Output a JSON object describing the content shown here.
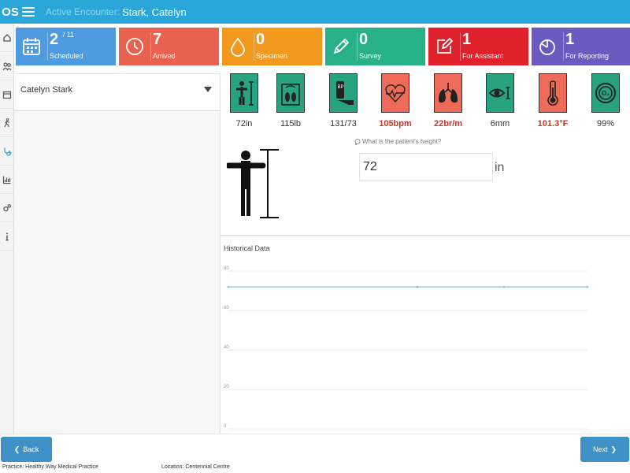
{
  "header": {
    "logo_text": "OS",
    "encounter_prefix": "Active Encounter:",
    "encounter_name": "Stark, Catelyn",
    "bg_color": "#2aa6d8"
  },
  "rail": {
    "items": [
      {
        "icon": "dashboard-icon"
      },
      {
        "icon": "patients-icon"
      },
      {
        "icon": "calendar-icon"
      },
      {
        "icon": "walking-person-icon"
      },
      {
        "icon": "stethoscope-icon",
        "active": true
      },
      {
        "icon": "bar-chart-icon"
      },
      {
        "icon": "settings-gears-icon"
      },
      {
        "icon": "info-icon"
      }
    ]
  },
  "tiles": [
    {
      "count": "2",
      "total": "/ 11",
      "label": "Scheduled",
      "color": "#4f9be0",
      "icon": "calendar-icon"
    },
    {
      "count": "7",
      "total": "",
      "label": "Arrived",
      "color": "#e8624f",
      "icon": "clock-icon"
    },
    {
      "count": "0",
      "total": "",
      "label": "Specimen",
      "color": "#f39a1e",
      "icon": "drop-icon"
    },
    {
      "count": "0",
      "total": "",
      "label": "Survey",
      "color": "#28b089",
      "icon": "pencil-icon"
    },
    {
      "count": "1",
      "total": "",
      "label": "For Assistant",
      "color": "#e0202a",
      "icon": "edit-icon"
    },
    {
      "count": "1",
      "total": "",
      "label": "For Reporting",
      "color": "#6b5bc1",
      "icon": "pie-chart-icon"
    }
  ],
  "patient": {
    "selected": "Catelyn Stark"
  },
  "vitals": [
    {
      "value": "72in",
      "color": "#28a37f",
      "icon": "height-icon",
      "alert": false
    },
    {
      "value": "115lb",
      "color": "#28a37f",
      "icon": "weight-icon",
      "alert": false
    },
    {
      "value": "131/73",
      "color": "#28a37f",
      "icon": "blood-pressure-icon",
      "alert": false
    },
    {
      "value": "105bpm",
      "color": "#ee6b5a",
      "icon": "heart-rate-icon",
      "alert": true
    },
    {
      "value": "22br/m",
      "color": "#ee6b5a",
      "icon": "lungs-icon",
      "alert": true
    },
    {
      "value": "6mm",
      "color": "#28a37f",
      "icon": "eye-icon",
      "alert": false
    },
    {
      "value": "101.3°F",
      "color": "#ee6b5a",
      "icon": "thermometer-icon",
      "alert": true
    },
    {
      "value": "99%",
      "color": "#28a37f",
      "icon": "oxygen-icon",
      "alert": false
    }
  ],
  "question": {
    "text": "What is the patient's height?",
    "value": "72",
    "unit": "in"
  },
  "history": {
    "title": "Historical Data"
  },
  "chart_data": {
    "type": "line",
    "title": "Historical Data",
    "ylim": [
      0,
      80
    ],
    "yticks": [
      "80",
      "60",
      "40",
      "20",
      "0"
    ],
    "grid": true,
    "series": [
      {
        "values": [
          72,
          72,
          72,
          72
        ]
      }
    ],
    "line_color": "#7fc7ce"
  },
  "footer": {
    "back_label": "Back",
    "next_label": "Next",
    "practice": "Practice: Healthy Way Medical Practice",
    "location": "Location: Centennial Centre"
  }
}
